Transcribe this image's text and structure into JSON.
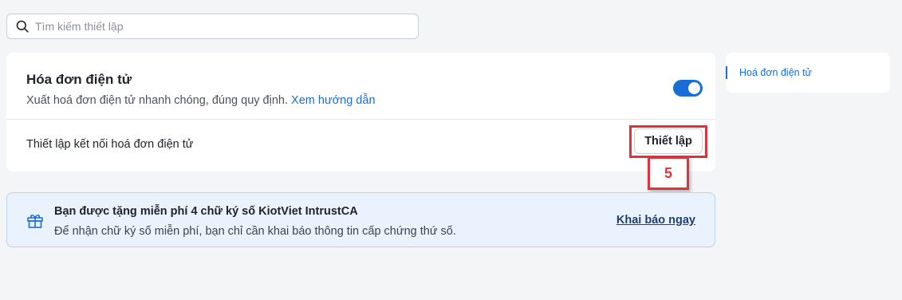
{
  "search": {
    "placeholder": "Tìm kiếm thiết lập",
    "value": ""
  },
  "einvoice": {
    "title": "Hóa đơn điện tử",
    "description": "Xuất hoá đơn điện tử nhanh chóng, đúng quy định.",
    "guide_link": "Xem hướng dẫn",
    "enabled": true,
    "connection_label": "Thiết lập kết nối hoá đơn điện tử",
    "setup_button": "Thiết lập"
  },
  "annotation": {
    "step_number": "5",
    "color": "#e0323b"
  },
  "promo": {
    "title": "Bạn được tặng miễn phí 4 chữ ký số KiotViet IntrustCA",
    "description": "Để nhận chữ ký số miễn phí, bạn chỉ cần khai báo thông tin cấp chứng thứ số.",
    "action": "Khai báo ngay"
  },
  "sidenav": {
    "items": [
      {
        "label": "Hoá đơn điện tử",
        "active": true
      }
    ]
  },
  "colors": {
    "accent": "#1a6dd6",
    "background": "#f4f5f7",
    "promo_bg": "#eaf3fd"
  },
  "icons": {
    "search": "search-icon",
    "gift": "gift-icon"
  }
}
